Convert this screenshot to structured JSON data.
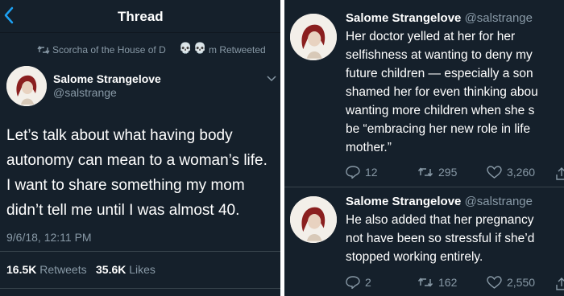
{
  "left": {
    "header": {
      "title": "Thread"
    },
    "retweet_banner": {
      "label": "Scorcha of the House of D",
      "suffix": "m Retweeted"
    },
    "tweet": {
      "author_name": "Salome Strangelove",
      "author_handle": "@salstrange",
      "text_lines": [
        "Let’s talk about what having body",
        "autonomy can mean to a woman’s life.",
        "I want to share something my mom",
        "didn’t tell me until I was almost 40."
      ],
      "timestamp": "9/6/18, 12:11 PM",
      "retweets_count": "16.5K",
      "retweets_label": "Retweets",
      "likes_count": "35.6K",
      "likes_label": "Likes"
    }
  },
  "right": {
    "replies": [
      {
        "author_name": "Salome Strangelove",
        "author_handle": "@salstrange",
        "text_lines": [
          "Her doctor yelled at her for her",
          "selfishness at wanting to deny my",
          "future children — especially a son",
          "shamed her for even thinking abou",
          "wanting more children when she s",
          "be “embracing her new role in life",
          "mother.”"
        ],
        "reply_count": "12",
        "retweet_count": "295",
        "like_count": "3,260"
      },
      {
        "author_name": "Salome Strangelove",
        "author_handle": "@salstrange",
        "text_lines": [
          "He also added that her pregnancy",
          "not have been so stressful if she’d",
          "stopped working entirely."
        ],
        "reply_count": "2",
        "retweet_count": "162",
        "like_count": "2,550"
      }
    ]
  },
  "colors": {
    "background": "#15202b",
    "accent": "#1da1f2",
    "muted_text": "#8899a6",
    "divider": "#38444d"
  },
  "icons": [
    "back-chevron-icon",
    "retweet-icon",
    "skull-icon",
    "chevron-down-icon",
    "reply-icon",
    "like-icon",
    "share-icon"
  ]
}
